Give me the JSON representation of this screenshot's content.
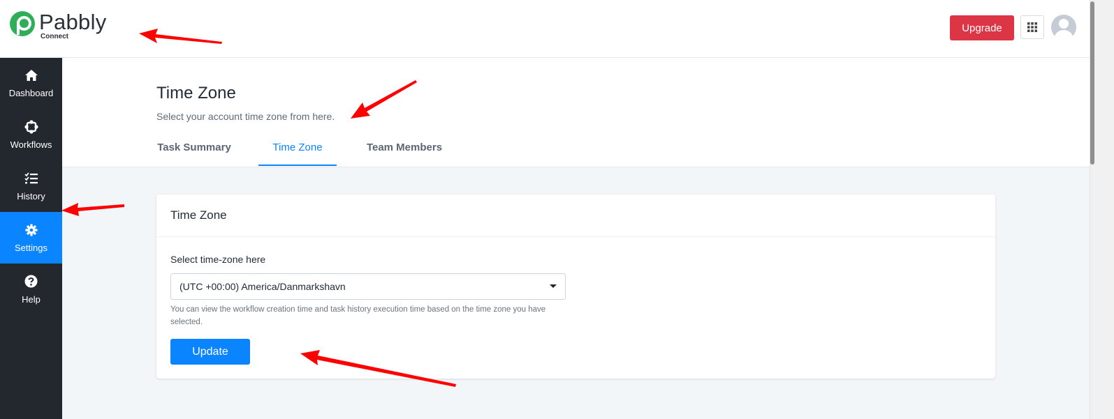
{
  "header": {
    "logo_name": "Pabbly",
    "logo_sub": "Connect",
    "upgrade_label": "Upgrade",
    "apps_icon": "grid-icon",
    "avatar_icon": "user-avatar-icon"
  },
  "sidebar": {
    "items": [
      {
        "label": "Dashboard",
        "icon": "home-icon"
      },
      {
        "label": "Workflows",
        "icon": "workflow-icon"
      },
      {
        "label": "History",
        "icon": "checklist-icon"
      },
      {
        "label": "Settings",
        "icon": "gear-icon",
        "active": true
      },
      {
        "label": "Help",
        "icon": "question-circle-icon"
      }
    ]
  },
  "page": {
    "title": "Time Zone",
    "subtitle": "Select your account time zone from here.",
    "tabs": [
      {
        "label": "Task Summary"
      },
      {
        "label": "Time Zone",
        "active": true
      },
      {
        "label": "Team Members"
      }
    ]
  },
  "card": {
    "title": "Time Zone",
    "field_label": "Select time-zone here",
    "select_value": "(UTC +00:00) America/Danmarkshavn",
    "help_text": "You can view the workflow creation time and task history execution time based on the time zone you have selected.",
    "update_label": "Update"
  },
  "colors": {
    "primary": "#0a84ff",
    "upgrade": "#dc3545",
    "sidebar_bg": "#23272e",
    "logo_green": "#2fae5a",
    "arrow": "#ff0000"
  }
}
